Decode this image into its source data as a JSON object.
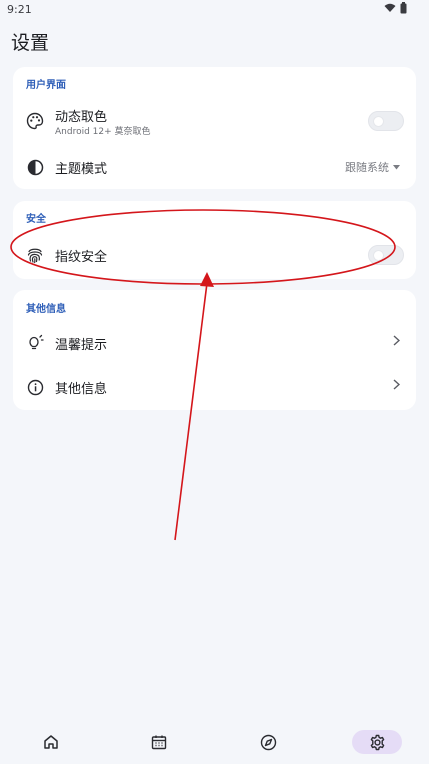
{
  "status": {
    "time": "9:21"
  },
  "page": {
    "title": "设置"
  },
  "sections": {
    "ui": {
      "title": "用户界面",
      "dynamic_color": {
        "label": "动态取色",
        "subtitle": "Android 12+ 莫奈取色",
        "enabled": false
      },
      "theme_mode": {
        "label": "主题模式",
        "value": "跟随系统"
      }
    },
    "security": {
      "title": "安全",
      "fingerprint": {
        "label": "指纹安全",
        "enabled": false
      }
    },
    "other": {
      "title": "其他信息",
      "tips": {
        "label": "温馨提示"
      },
      "info": {
        "label": "其他信息"
      }
    }
  },
  "bottom_nav": {
    "items": [
      {
        "icon": "home-icon"
      },
      {
        "icon": "calendar-icon"
      },
      {
        "icon": "compass-icon"
      },
      {
        "icon": "settings-icon",
        "active": true
      }
    ]
  },
  "annotation": {
    "color": "#d4161b"
  }
}
